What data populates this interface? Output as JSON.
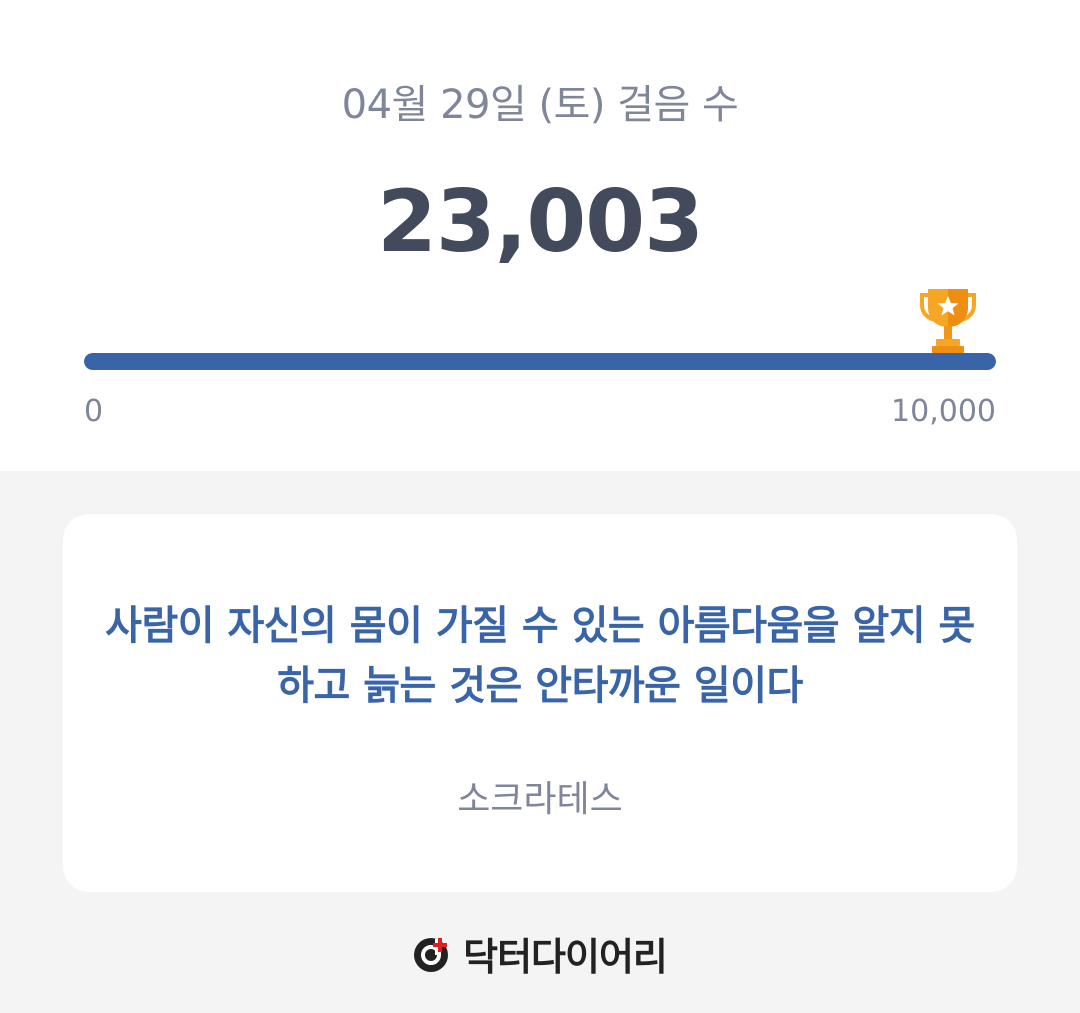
{
  "summary": {
    "date_title": "04월 29일 (토) 걸음 수",
    "step_count": "23,003",
    "progress": {
      "value": 23003,
      "goal": 10000,
      "fill_fraction": 1.0,
      "min_label": "0",
      "max_label": "10,000"
    },
    "trophy_icon": "trophy-icon"
  },
  "quote": {
    "text": "사람이 자신의 몸이 가질 수 있는 아름다움을 알지 못하고 늙는 것은 안타까운 일이다",
    "author": "소크라테스"
  },
  "footer": {
    "brand_name": "닥터다이어리",
    "brand_icon": "doctor-diary-logo-icon"
  },
  "colors": {
    "accent": "#3a64a8",
    "trophy": "#f5a623",
    "text_muted": "#80869a",
    "text_strong": "#434a5c",
    "logo_red": "#e02020"
  }
}
